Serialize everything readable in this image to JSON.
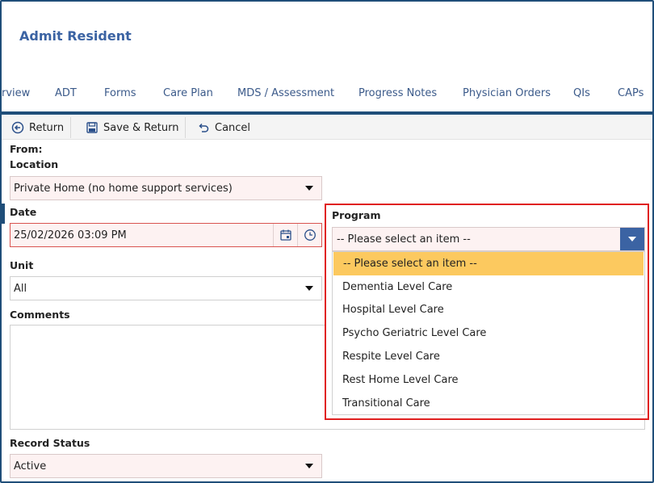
{
  "header": {
    "title": "Admit Resident"
  },
  "tabs": [
    "rview",
    "ADT",
    "Forms",
    "Care Plan",
    "MDS / Assessment",
    "Progress Notes",
    "Physician Orders",
    "QIs",
    "CAPs"
  ],
  "toolbar": {
    "return_label": "Return",
    "save_return_label": "Save & Return",
    "cancel_label": "Cancel"
  },
  "form": {
    "from_label": "From:",
    "location_label": "Location",
    "location_value": "Private Home (no home support services)",
    "date_label": "Date",
    "date_value": "25/02/2026 03:09 PM",
    "unit_label": "Unit",
    "unit_value": "All",
    "comments_label": "Comments",
    "record_status_label": "Record Status",
    "record_status_value": "Active"
  },
  "program": {
    "label": "Program",
    "selected": "-- Please select an item --",
    "options": [
      "-- Please select an item --",
      "Dementia Level Care",
      "Hospital Level Care",
      "Psycho Geriatric Level Care",
      "Respite Level Care",
      "Rest Home Level Care",
      "Transitional Care"
    ]
  },
  "colors": {
    "accent": "#1f4e79",
    "title": "#3b63a3",
    "highlight": "#fcc95f",
    "error": "#e02020"
  }
}
